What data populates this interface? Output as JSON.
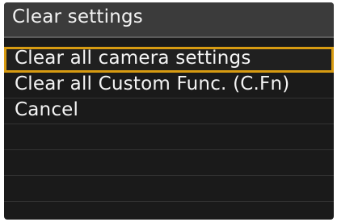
{
  "screen": {
    "title": "Clear settings",
    "menu": [
      {
        "label": "Clear all camera settings",
        "selected": true
      },
      {
        "label": "Clear all Custom Func. (C.Fn)",
        "selected": false
      },
      {
        "label": "Cancel",
        "selected": false
      }
    ],
    "colors": {
      "background": "#1a1a1a",
      "title_bar": "#3b3b3b",
      "selection_border": "#d79b12",
      "text": "#f4f4f4"
    }
  }
}
